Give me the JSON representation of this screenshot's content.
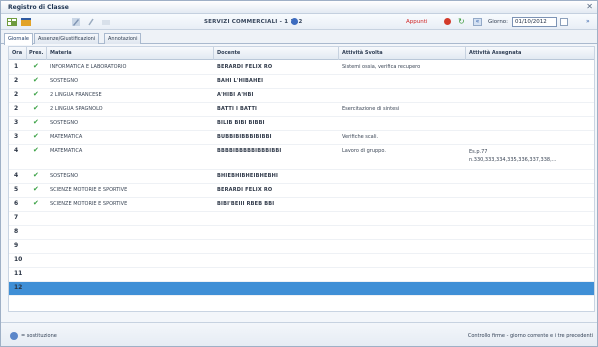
{
  "window": {
    "title": "Registro di Classe"
  },
  "toolbar": {
    "class_label": "SERVIZI COMMERCIALI - 1 112",
    "appunti_label": "Appunti",
    "giorno_label": "Giorno:",
    "date_value": "01/10/2012"
  },
  "tabs": [
    {
      "label": "Giornale"
    },
    {
      "label": "Assenze/Giustificazioni"
    },
    {
      "label": "Annotazioni"
    }
  ],
  "table": {
    "headers": {
      "ora": "Ora",
      "pres": "Pres.",
      "materia": "Materia",
      "docente": "Docente",
      "svolta": "Attività Svolta",
      "assegnata": "Attività Assegnata"
    },
    "rows": [
      {
        "ora": "1",
        "check": true,
        "materia": "INFORMATICA E LABORATORIO",
        "docente": "BERARDI FELIX RO",
        "svolta": "Sistemi ossia, verifica recupero",
        "assegnata": ""
      },
      {
        "ora": "2",
        "check": true,
        "materia": "SOSTEGNO",
        "docente": "BAHI L'HIBAHEI",
        "svolta": "",
        "assegnata": ""
      },
      {
        "ora": "2",
        "check": true,
        "materia": "2 LINGUA FRANCESE",
        "docente": "A'HIBI   A'HBI",
        "svolta": "",
        "assegnata": ""
      },
      {
        "ora": "2",
        "check": true,
        "materia": "2 LINGUA SPAGNOLO",
        "docente": "BATTI I    BATTI",
        "svolta": "Esercitazione di sintesi",
        "assegnata": ""
      },
      {
        "ora": "3",
        "check": true,
        "materia": "SOSTEGNO",
        "docente": "BILIB BIBI BIBBI",
        "svolta": "",
        "assegnata": ""
      },
      {
        "ora": "3",
        "check": true,
        "materia": "MATEMATICA",
        "docente": "BUBBIBIBBBIBIBBI",
        "svolta": "Verifiche scali.",
        "assegnata": ""
      },
      {
        "ora": "4",
        "check": true,
        "materia": "MATEMATICA",
        "docente": "BBBBIBBBBBIBBBIBBI",
        "svolta": "Lavoro di gruppo.",
        "assegnata": "Es.p.77\nn.330,333,334,335,336,337,338,..."
      },
      {
        "ora": "4",
        "check": true,
        "materia": "SOSTEGNO",
        "docente": "BHIEBHIBHEIBHEBHI",
        "svolta": "",
        "assegnata": ""
      },
      {
        "ora": "5",
        "check": true,
        "materia": "SCIENZE MOTORIE E SPORTIVE",
        "docente": "BERARDI FELIX RO",
        "svolta": "",
        "assegnata": ""
      },
      {
        "ora": "6",
        "check": true,
        "materia": "SCIENZE MOTORIE E SPORTIVE",
        "docente": "BIBI'BEIII RBEB BBI",
        "svolta": "",
        "assegnata": ""
      },
      {
        "ora": "7",
        "check": false,
        "materia": "",
        "docente": "",
        "svolta": "",
        "assegnata": ""
      },
      {
        "ora": "8",
        "check": false,
        "materia": "",
        "docente": "",
        "svolta": "",
        "assegnata": ""
      },
      {
        "ora": "9",
        "check": false,
        "materia": "",
        "docente": "",
        "svolta": "",
        "assegnata": ""
      },
      {
        "ora": "10",
        "check": false,
        "materia": "",
        "docente": "",
        "svolta": "",
        "assegnata": ""
      },
      {
        "ora": "11",
        "check": false,
        "materia": "",
        "docente": "",
        "svolta": "",
        "assegnata": ""
      },
      {
        "ora": "12",
        "check": false,
        "materia": "",
        "docente": "",
        "svolta": "",
        "assegnata": "",
        "selected": true
      }
    ]
  },
  "statusbar": {
    "legend_text": "= sostituzione",
    "right_text": "Controllo firme - giorno corrente e i tre precedenti"
  },
  "colors": {
    "selected_row": "#3f8fd6",
    "check": "#3aa144",
    "appunti": "#d02424"
  }
}
